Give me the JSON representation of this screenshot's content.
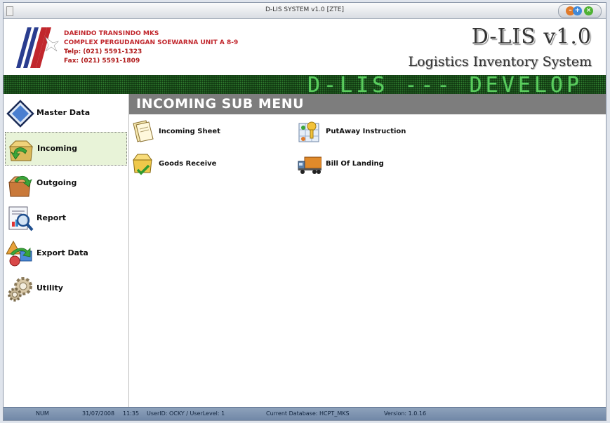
{
  "window": {
    "title": "D-LIS SYSTEM v1.0 [ZTE]"
  },
  "company": {
    "name": "DAEINDO TRANSINDO MKS",
    "address": "COMPLEX PERGUDANGAN SOEWARNA UNIT A 8-9",
    "phone": "Telp: (021) 5591-1323",
    "fax": "Fax: (021) 5591-1809"
  },
  "app": {
    "title": "D-LIS v1.0",
    "subtitle": "Logistics Inventory System"
  },
  "ticker": {
    "text": "D-LIS --- DEVELOP"
  },
  "sidebar": {
    "items": [
      {
        "label": "Master Data",
        "icon": "diamond-icon"
      },
      {
        "label": "Incoming",
        "icon": "incoming-box-icon",
        "active": true
      },
      {
        "label": "Outgoing",
        "icon": "outgoing-box-icon"
      },
      {
        "label": "Report",
        "icon": "report-magnifier-icon"
      },
      {
        "label": "Export Data",
        "icon": "export-data-icon"
      },
      {
        "label": "Utility",
        "icon": "gears-icon"
      }
    ]
  },
  "main": {
    "title": "INCOMING SUB MENU",
    "items": [
      {
        "label": "Incoming Sheet",
        "icon": "sheet-icon"
      },
      {
        "label": "PutAway Instruction",
        "icon": "putaway-icon"
      },
      {
        "label": "Goods Receive",
        "icon": "goods-box-check-icon"
      },
      {
        "label": "Bill Of Landing",
        "icon": "truck-icon"
      }
    ]
  },
  "status": {
    "mode": "NUM",
    "date": "31/07/2008",
    "time": "11:35",
    "user": "UserID: OCKY / UserLevel: 1",
    "database": "Current Database: HCPT_MKS",
    "version": "Version: 1.0.16"
  }
}
